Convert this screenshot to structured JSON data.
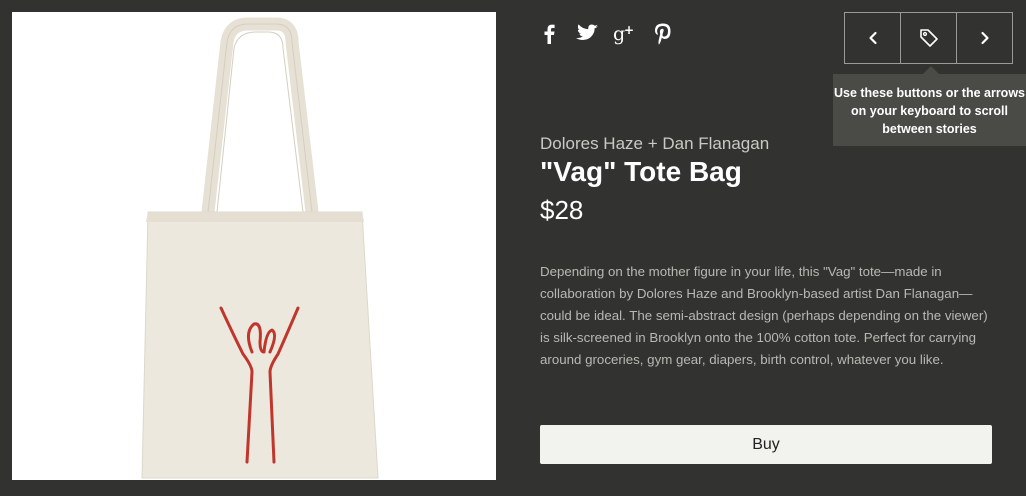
{
  "product": {
    "brand": "Dolores Haze + Dan Flanagan",
    "title": "\"Vag\" Tote Bag",
    "price": "$28",
    "description": "Depending on the mother figure in your life, this \"Vag\" tote—made in collaboration by Dolores Haze and Brooklyn-based artist Dan Flanagan—could be ideal. The semi-abstract design (perhaps depending on the viewer) is silk-screened in Brooklyn onto the 100% cotton tote. Perfect for carrying around groceries, gym gear, diapers, birth control, whatever you like.",
    "buy_label": "Buy",
    "image_icon": "tote-bag-image"
  },
  "social": {
    "icons": [
      "facebook-icon",
      "twitter-icon",
      "google-plus-icon",
      "pinterest-icon"
    ]
  },
  "nav": {
    "icons": [
      "chevron-left-icon",
      "tag-icon",
      "chevron-right-icon"
    ],
    "tooltip": "Use these buttons or the arrows on your keyboard to scroll between stories"
  },
  "colors": {
    "background": "#323230",
    "button": "#f2f2ef",
    "tooltip": "#4a4a47",
    "print": "#c0362c",
    "tote": "#ece8dd"
  }
}
